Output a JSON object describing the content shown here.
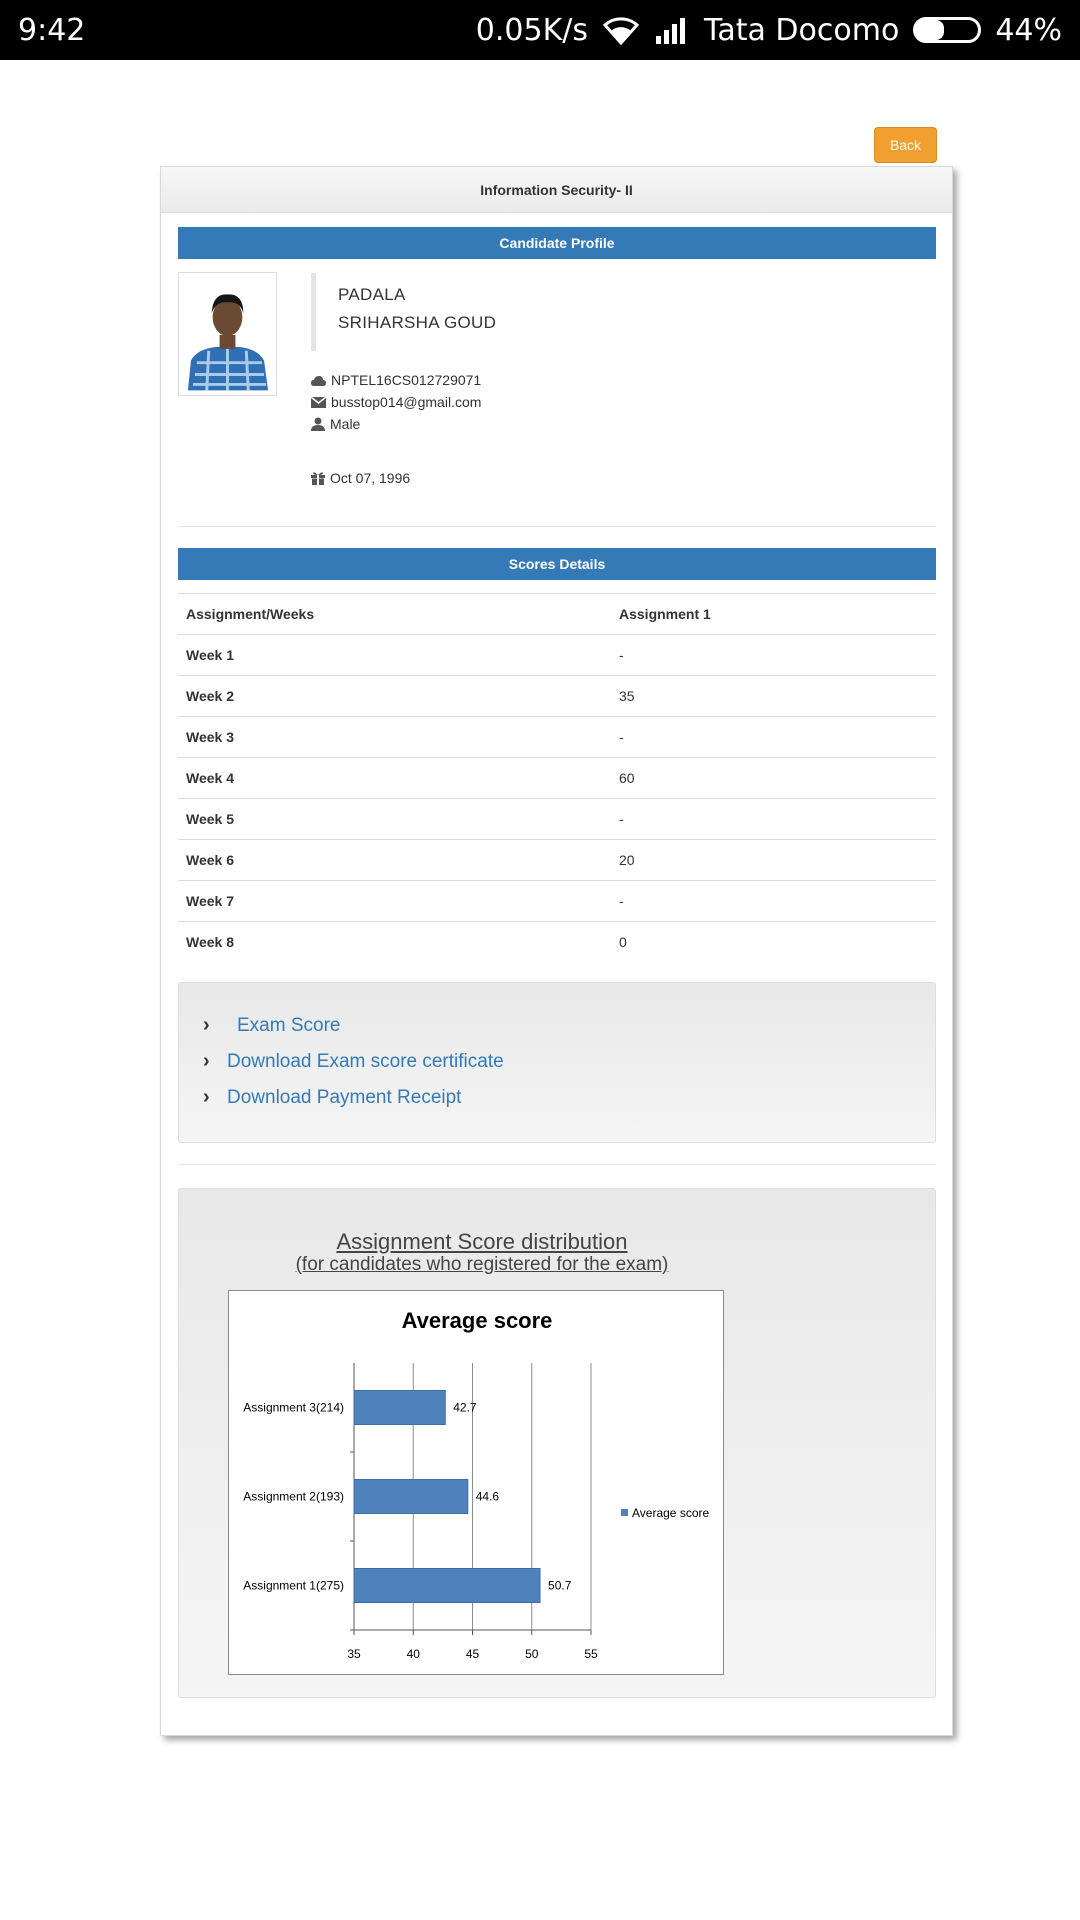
{
  "statusbar": {
    "time": "9:42",
    "speed": "0.05K/s",
    "carrier": "Tata Docomo",
    "battery": "44%",
    "battery_level": 0.44
  },
  "back_label": "Back",
  "card": {
    "title": "Information Security- II",
    "profile_header": "Candidate Profile",
    "name_line1": "PADALA",
    "name_line2": "SRIHARSHA GOUD",
    "reg_id": "NPTEL16CS012729071",
    "email": "busstop014@gmail.com",
    "gender": "Male",
    "dob": "Oct 07, 1996",
    "scores_header": "Scores Details",
    "table": {
      "col1": "Assignment/Weeks",
      "col2": "Assignment 1",
      "rows": [
        {
          "week": "Week 1",
          "score": "-"
        },
        {
          "week": "Week 2",
          "score": "35"
        },
        {
          "week": "Week 3",
          "score": "-"
        },
        {
          "week": "Week 4",
          "score": "60"
        },
        {
          "week": "Week 5",
          "score": "-"
        },
        {
          "week": "Week 6",
          "score": "20"
        },
        {
          "week": "Week 7",
          "score": "-"
        },
        {
          "week": "Week 8",
          "score": "0"
        }
      ]
    },
    "links": {
      "exam_score": "Exam Score",
      "download_certificate": "Download Exam score certificate",
      "download_receipt": "Download Payment Receipt"
    },
    "distribution_title": "Assignment Score distribution",
    "distribution_subtitle": "(for candidates who registered for the exam)"
  },
  "chart_data": {
    "type": "bar",
    "orientation": "horizontal",
    "title": "Average score",
    "categories": [
      "Assignment 3(214)",
      "Assignment 2(193)",
      "Assignment 1(275)"
    ],
    "series": [
      {
        "name": "Average score",
        "values": [
          42.7,
          44.6,
          50.7
        ]
      }
    ],
    "xlim": [
      35,
      55
    ],
    "xticks": [
      "35",
      "40",
      "45",
      "50",
      "55"
    ],
    "grid": true,
    "legend": "right",
    "bar_color": "#4f81bd"
  }
}
